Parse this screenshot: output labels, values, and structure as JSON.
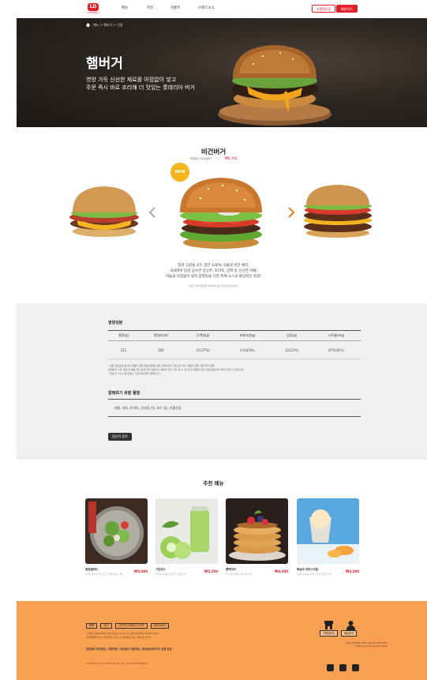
{
  "header": {
    "logo_mark": "LO",
    "logo_word": "LOTTERIA",
    "nav": [
      "메뉴",
      "주문",
      "이벤트",
      "브랜드소식"
    ],
    "franchise_button": "가맹점모집",
    "order_button": "배달하기"
  },
  "hero": {
    "breadcrumb": "메뉴 > 햄버거 > 인용",
    "title": "햄버거",
    "subtitle_line1": "영양 가득 신선한 재료를 아낌없이 넣고",
    "subtitle_line2": "주문 즉시 바로 조리해 더 맛있는 롯데리아 버거"
  },
  "product": {
    "name": "비건버거",
    "name_en": "Vegan burger",
    "price": "₩6,700",
    "badge": "NEW",
    "desc_line1": "밀과 식감을 모두 잡은 100% 식물성 비건 패티,",
    "desc_line2": "국내에서 당일 공수한 양상추, 토마토, 양파 등 신선한 야채,",
    "desc_line3": "마늘을 아낌없이 넣어 감칠맛을 더한 특제 소스의 환상적인 조합!",
    "note": "*비건 버거 제조를 이해하여 생산 제조 하였습니다."
  },
  "nutrition": {
    "title": "영양성분",
    "headers": [
      "중량(g)",
      "열량(kcal)",
      "단백질(g)",
      "포화지방(g)",
      "당류(g)",
      "나트륨(mg)"
    ],
    "values": [
      "111",
      "585",
      "21(37%)",
      "6.4(43%)",
      "12(22%)",
      "875(44%)"
    ],
    "note1": "- 영양 정보표에 표시된 제품의 영양 정보(영양분 표준 데이터)를 기준으로 하나, 제품의 변화, 원산지의 변화,",
    "note2": "  원재료의 수급 상황 및 제품 개선 등에 따라 함량이나 중량이 약간 차이 날 수 있으므로 제품의 영양 정보(함량)와 차이가 있을 수 있습니다.",
    "note3": "- 괄호 안 %는 1일 영양소 기준치에 대한 비율입니다.",
    "allergen_title": "알레르기 유발 물질",
    "allergen_text": "메밀, 대두, 토마토, 견과류 (잣, 호두 등), 아황산류",
    "origin_button": "원산지 정보"
  },
  "recommend": {
    "title": "추천 메뉴",
    "items": [
      {
        "name": "정원샐러드",
        "sub": "신선한 채소를 가득 담은 건강한 샐러드 메뉴",
        "price": "₩5,000"
      },
      {
        "name": "그린주스",
        "sub": "케일과 사과를 갈아 만든 상큼한 주스",
        "price": "₩5,200"
      },
      {
        "name": "팬케이크",
        "sub": "부드러운 팬케이크와 딸기 토핑",
        "price": "₩4,000"
      },
      {
        "name": "복숭아 아이스크림",
        "sub": "달콤한 복숭아 과육이 들어간 아이스크림",
        "price": "₩4,300"
      }
    ]
  },
  "footer": {
    "links": [
      "회원",
      "공고",
      "LOTTE FAMILY SITE",
      "ENGLISH"
    ],
    "info1": "고객센터 1600-9999 | 대표전화 02-709-1114 | 사업자등록번호 120-81-06141",
    "info2": "롯데지알에스(주) | 서울특별시 금천구 가산디지털1로 25 | 대표이사 차우철",
    "policy": "개인정보 처리방침 | 이용약관 | 위치정보 이용약관 | 영상정보처리기기 운영 방침",
    "copyright": "COPYRIGHT © 2023 LOTTE GRS CO., LTD. ALL RIGHTS RESERVED",
    "btn_franchise": "가맹점모집",
    "btn_delivery": "배달문의",
    "right_line1": "가맹점 문의 1600-1234 | 배달 문의 1600-5678",
    "right_line2": "고객센터 운영시간 평일 09:00~18:00"
  },
  "colors": {
    "brand_red": "#e0212c",
    "footer_orange": "#f9a053",
    "hero_dark": "#2b2622"
  }
}
